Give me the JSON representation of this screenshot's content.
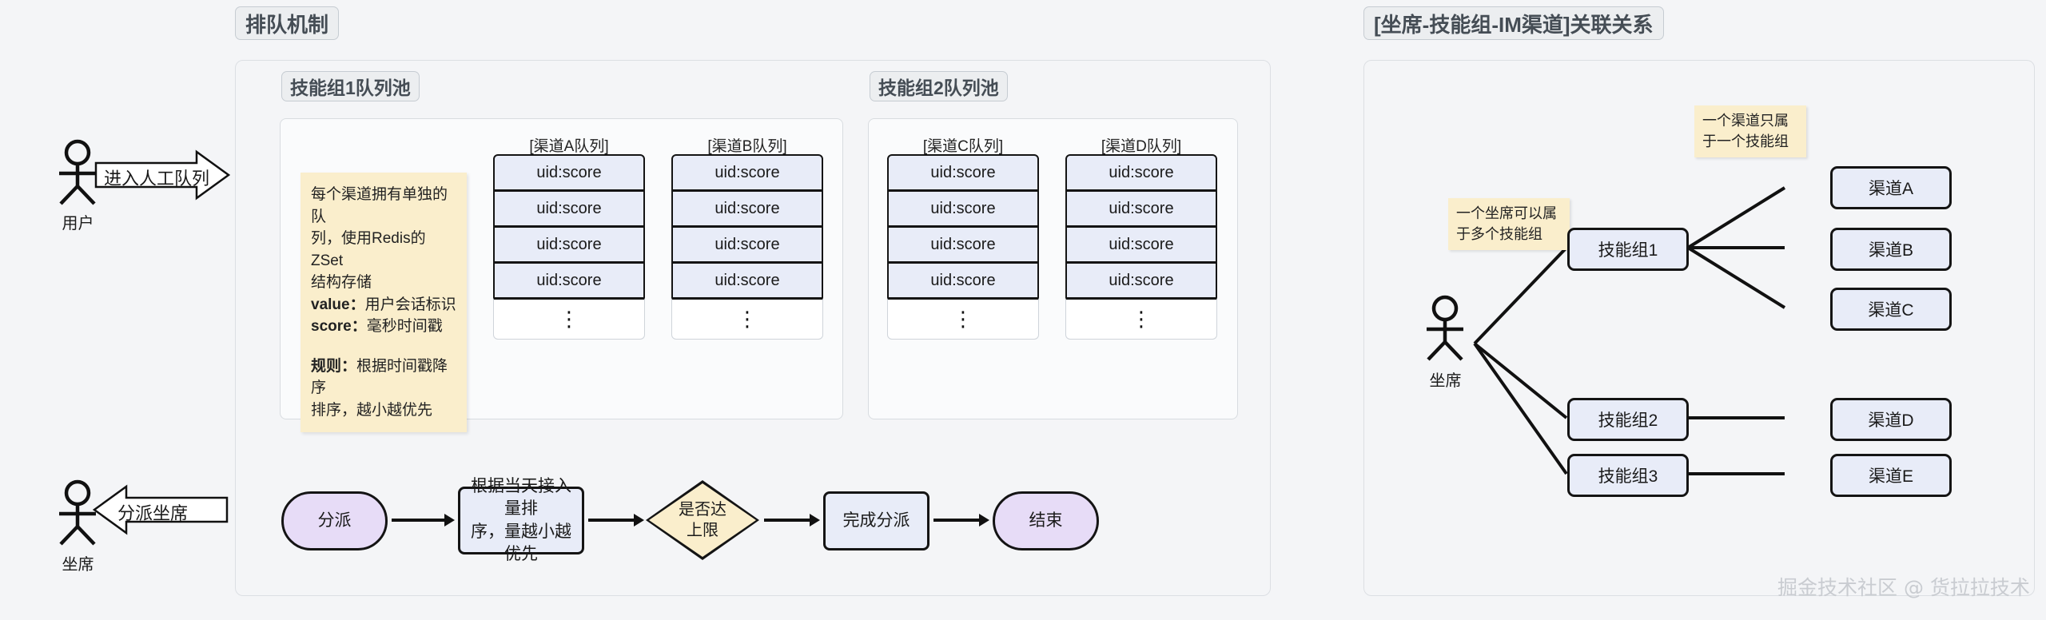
{
  "left_panel": {
    "title": "排队机制",
    "pool1": {
      "title": "技能组1队列池",
      "note": {
        "line1": "每个渠道拥有单独的队",
        "line2": "列，使用Redis的ZSet",
        "line3": "结构存储",
        "label_value": "value：",
        "value_text": "用户会话标识",
        "label_score": "score：",
        "score_text": "毫秒时间戳",
        "label_rule": "规则：",
        "rule_text": "根据时间戳降序",
        "rule_text2": "排序，越小越优先"
      },
      "queues": [
        {
          "header": "[渠道A队列]",
          "cells": [
            "uid:score",
            "uid:score",
            "uid:score",
            "uid:score"
          ],
          "ellipsis": "⋮"
        },
        {
          "header": "[渠道B队列]",
          "cells": [
            "uid:score",
            "uid:score",
            "uid:score",
            "uid:score"
          ],
          "ellipsis": "⋮"
        }
      ]
    },
    "pool2": {
      "title": "技能组2队列池",
      "queues": [
        {
          "header": "[渠道C队列]",
          "cells": [
            "uid:score",
            "uid:score",
            "uid:score",
            "uid:score"
          ],
          "ellipsis": "⋮"
        },
        {
          "header": "[渠道D队列]",
          "cells": [
            "uid:score",
            "uid:score",
            "uid:score",
            "uid:score"
          ],
          "ellipsis": "⋮"
        }
      ]
    },
    "flow": {
      "start": "分派",
      "step1_line1": "根据当天接入量排",
      "step1_line2": "序，量越小越优先",
      "decision_line1": "是否达",
      "decision_line2": "上限",
      "step2": "完成分派",
      "end": "结束"
    }
  },
  "actors": {
    "user_label": "用户",
    "user_arrow": "进入人工队列",
    "agent_label": "坐席",
    "agent_arrow": "分派坐席"
  },
  "right_panel": {
    "title": "[坐席-技能组-IM渠道]关联关系",
    "actor_label": "坐席",
    "note_agent": "一个坐席可以属\n于多个技能组",
    "note_channel": "一个渠道只属\n于一个技能组",
    "skill_groups": [
      "技能组1",
      "技能组2",
      "技能组3"
    ],
    "channels": [
      "渠道A",
      "渠道B",
      "渠道C",
      "渠道D",
      "渠道E"
    ]
  },
  "watermark": "掘金技术社区 @ 货拉拉技术",
  "colors": {
    "background": "#f4f5f7",
    "cell_fill": "#e8ecf8",
    "note_fill": "#faeecc",
    "stadium_fill": "#e7dcf7",
    "stroke": "#141414"
  }
}
